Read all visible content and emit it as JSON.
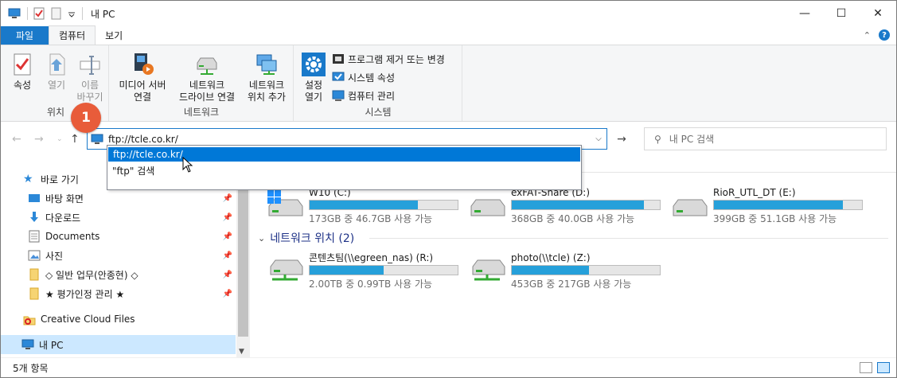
{
  "window": {
    "title": "내 PC",
    "min_icon": "minimize-icon",
    "max_icon": "maximize-icon",
    "close_icon": "close-icon"
  },
  "tabs": [
    {
      "label": "파일"
    },
    {
      "label": "컴퓨터"
    },
    {
      "label": "보기"
    }
  ],
  "ribbon": {
    "location": {
      "label": "위치",
      "properties": "속성",
      "open": "열기",
      "rename_line1": "이름",
      "rename_line2": "바꾸기"
    },
    "network": {
      "label": "네트워크",
      "media_line1": "미디어 서버",
      "media_line2": "연결",
      "map_line1": "네트워크",
      "map_line2": "드라이브 연결",
      "add_line1": "네트워크",
      "add_line2": "위치 추가"
    },
    "system": {
      "label": "시스템",
      "settings_line1": "설정",
      "settings_line2": "열기",
      "uninstall": "프로그램 제거 또는 변경",
      "sys_props": "시스템 속성",
      "manage": "컴퓨터 관리"
    }
  },
  "address": {
    "value": "ftp://tcle.co.kr/"
  },
  "search": {
    "placeholder": "내 PC 검색"
  },
  "suggestions": [
    {
      "text": "ftp://tcle.co.kr/"
    },
    {
      "text": "\"ftp\" 검색"
    }
  ],
  "badge": {
    "number": "1"
  },
  "sidebar": {
    "items": [
      {
        "label": "바로 가기",
        "icon": "star-icon"
      },
      {
        "label": "바탕 화면",
        "icon": "desktop-icon"
      },
      {
        "label": "다운로드",
        "icon": "download-icon"
      },
      {
        "label": "Documents",
        "icon": "documents-icon"
      },
      {
        "label": "사진",
        "icon": "pictures-icon"
      },
      {
        "label": "◇ 일반 업무(안종현) ◇",
        "icon": "folder-icon"
      },
      {
        "label": "★ 평가인정 관리 ★",
        "icon": "folder-icon"
      },
      {
        "label": "Creative Cloud Files",
        "icon": "creative-cloud-icon"
      },
      {
        "label": "내 PC",
        "icon": "this-pc-icon"
      }
    ]
  },
  "drives": [
    {
      "name": "W10 (C:)",
      "size": "173GB 중 46.7GB 사용 가능",
      "used_fraction": 0.73
    },
    {
      "name": "exFAT-Share (D:)",
      "size": "368GB 중 40.0GB 사용 가능",
      "used_fraction": 0.89
    },
    {
      "name": "RioR_UTL_DT (E:)",
      "size": "399GB 중 51.1GB 사용 가능",
      "used_fraction": 0.87
    }
  ],
  "network_section": {
    "title": "네트워크 위치 (2)"
  },
  "network_drives": [
    {
      "name": "콘텐츠팀(\\\\egreen_nas) (R:)",
      "size": "2.00TB 중 0.99TB 사용 가능",
      "used_fraction": 0.5
    },
    {
      "name": "photo(\\\\tcle) (Z:)",
      "size": "453GB 중 217GB 사용 가능",
      "used_fraction": 0.52
    }
  ],
  "status": {
    "count": "5개 항목"
  },
  "colors": {
    "accent": "#1979ca",
    "bar": "#26a0da",
    "badge": "#e85c3a",
    "selection": "#0078d7"
  }
}
